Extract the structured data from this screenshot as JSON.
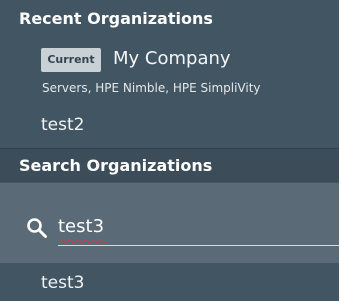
{
  "recent": {
    "header": "Recent Organizations",
    "current_org": {
      "badge": "Current",
      "name": "My Company",
      "services": "Servers, HPE Nimble, HPE SimpliVity"
    },
    "other_orgs": [
      "test2"
    ]
  },
  "search": {
    "header": "Search Organizations",
    "query": "test3",
    "icon": "search-icon"
  },
  "results": [
    "test3"
  ],
  "colors": {
    "panel_bg": "#425563",
    "search_bg": "#5a6a76",
    "badge_bg": "#c9d1d6",
    "spellcheck": "#d23b3b"
  }
}
